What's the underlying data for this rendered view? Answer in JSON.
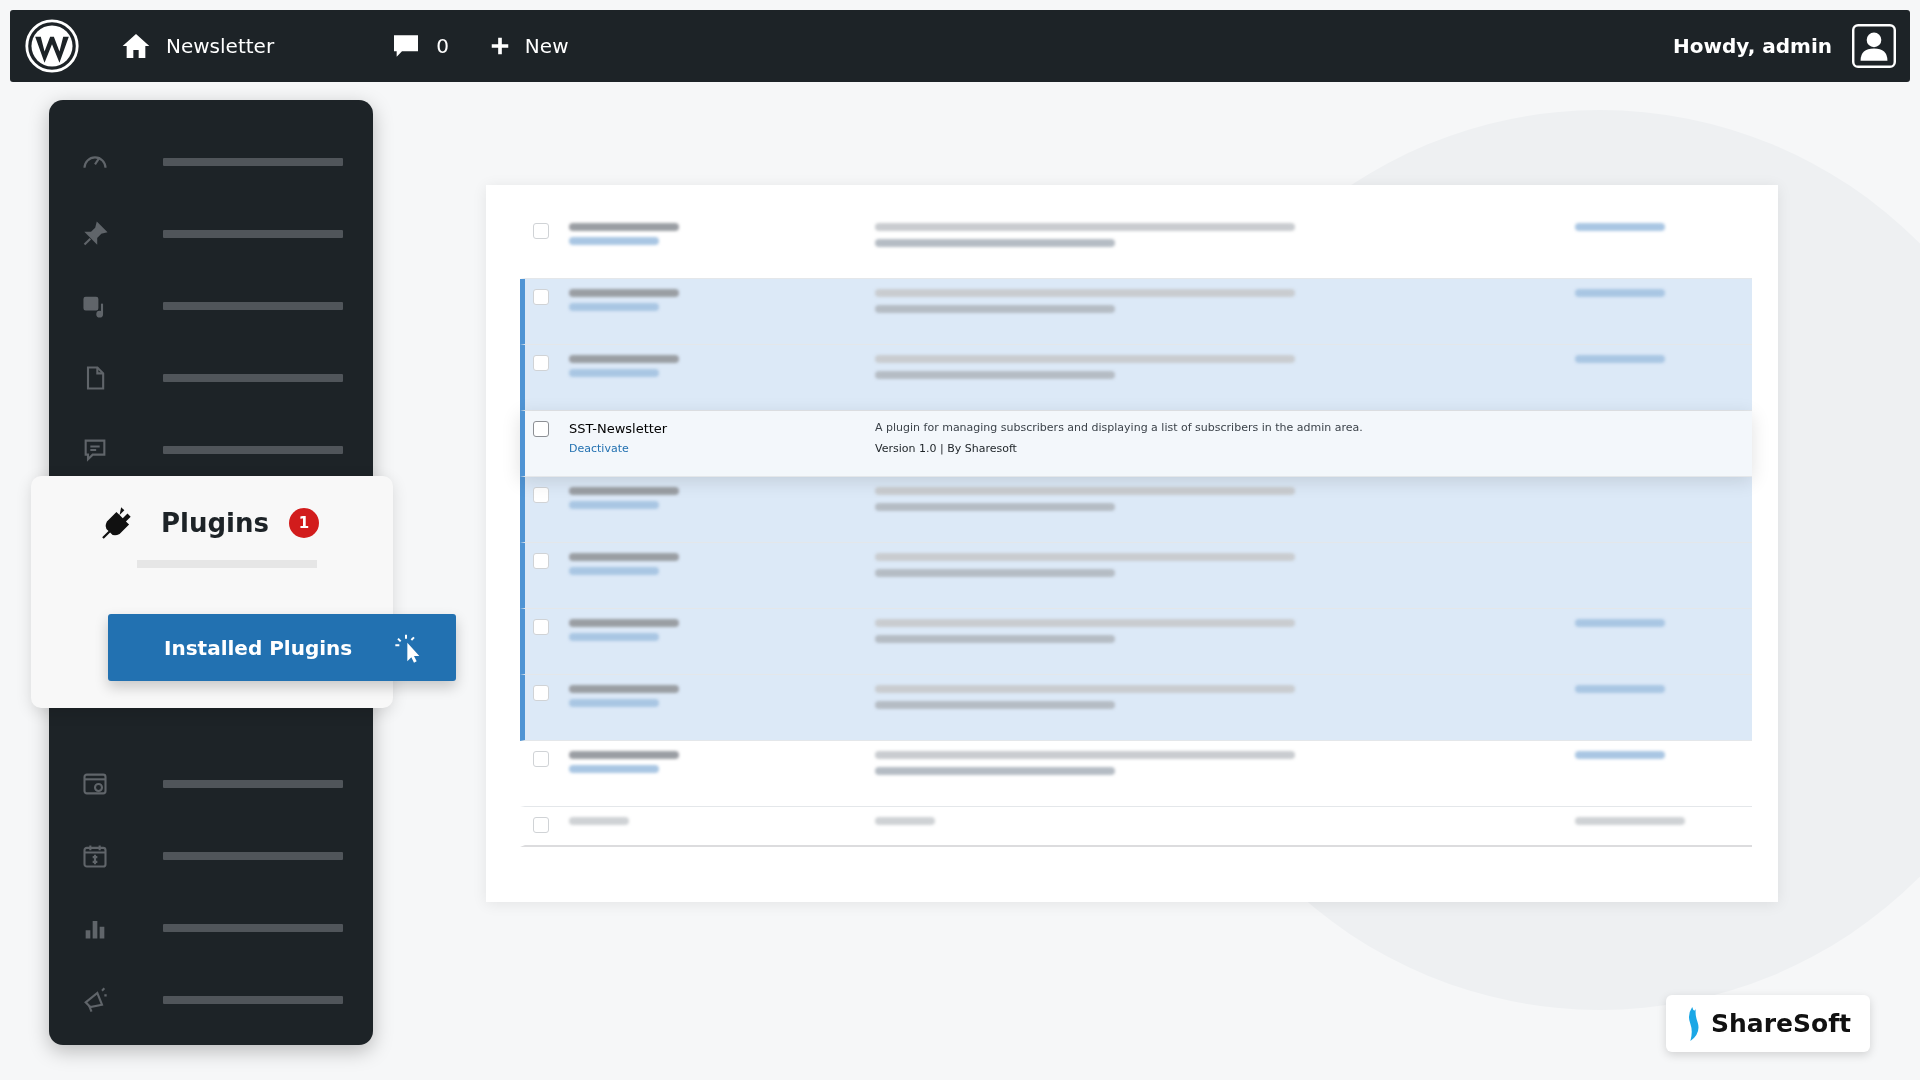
{
  "admin_bar": {
    "site_name": "Newsletter",
    "comments_count": "0",
    "new_label": "New",
    "greeting": "Howdy, admin"
  },
  "sidebar": {
    "top_items": [
      {
        "kind": "gauge"
      },
      {
        "kind": "pin"
      },
      {
        "kind": "media"
      },
      {
        "kind": "page"
      },
      {
        "kind": "comment"
      }
    ],
    "menu": {
      "label": "Plugins",
      "badge": "1",
      "submenu": {
        "label": "Installed Plugins",
        "selected": true
      }
    },
    "bottom_items": [
      {
        "kind": "archive"
      },
      {
        "kind": "calendar"
      },
      {
        "kind": "chart"
      },
      {
        "kind": "megaphone"
      }
    ]
  },
  "plugins": {
    "rows": [
      {
        "kind": "blurred",
        "active": false,
        "auto_update": true,
        "checked": false
      },
      {
        "kind": "blurred",
        "active": true,
        "auto_update": true,
        "checked": false
      },
      {
        "kind": "blurred",
        "active": true,
        "auto_update": true,
        "checked": false
      },
      {
        "kind": "plugin",
        "name": "SST-Newsletter",
        "action": "Deactivate",
        "description": "A plugin for managing subscribers and displaying a list of subscribers in the admin area.",
        "meta": "Version 1.0 | By Sharesoft",
        "active": true,
        "checked": false
      },
      {
        "kind": "blurred",
        "active": true,
        "auto_update": false,
        "checked": false
      },
      {
        "kind": "blurred",
        "active": true,
        "auto_update": false,
        "checked": false
      },
      {
        "kind": "blurred",
        "active": true,
        "auto_update": true,
        "checked": false
      },
      {
        "kind": "blurred",
        "active": true,
        "auto_update": true,
        "checked": false
      },
      {
        "kind": "blurred",
        "active": false,
        "auto_update": true,
        "checked": false
      }
    ],
    "footer": {
      "checked": false
    }
  },
  "brand": {
    "name": "ShareSoft"
  }
}
